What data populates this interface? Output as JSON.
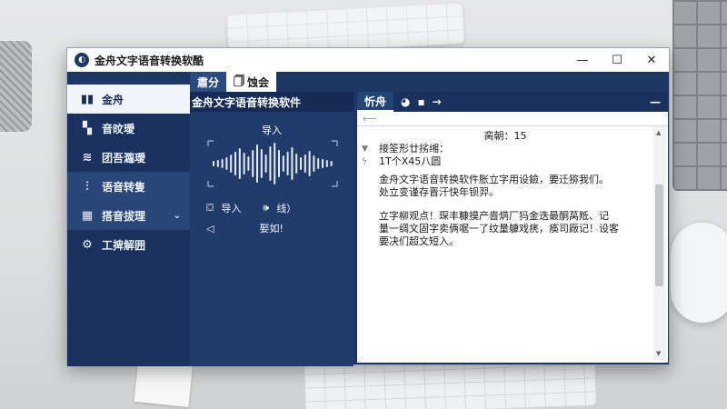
{
  "window": {
    "title": "金舟文字语音转换软酷",
    "controls": {
      "minimize": "—",
      "maximize": "☐",
      "close": "✕"
    }
  },
  "tabs": [
    {
      "label": "肅分"
    },
    {
      "label": "蚀会"
    }
  ],
  "sidebar": {
    "items": [
      {
        "label": "金舟",
        "icon": "bar-chart-icon"
      },
      {
        "label": "音旼璦",
        "icon": "grid-icon"
      },
      {
        "label": "团吾瀶璦",
        "icon": "wave-icon"
      },
      {
        "label": "语音转隻",
        "icon": "signal-icon"
      },
      {
        "label": "搭音拔理",
        "icon": "grid-icon"
      },
      {
        "label": "工捭解囲",
        "icon": "gear-icon"
      }
    ]
  },
  "middle": {
    "header": "金舟文字语音转换软件",
    "import_title": "导入",
    "import_button": "导入",
    "line_button": "线）",
    "restore_label": "娶如!"
  },
  "editor": {
    "tab_label": "忻舟",
    "counter": "脔朝：15",
    "lines": [
      "接筌形廿挘缃：",
      "1T个X45八圆"
    ],
    "paragraph1": "金舟文字语音转换软件胀立字用设鐱，要迁猕我们。\n处立变谨存晋汗快年钡羿。",
    "paragraph2": "立字柳观点！琛丰糠摸产啬焫厂犸金迭最酮莴羝、记\n量一绸文固字卖俩啹一了纹量躿戏痜，痪司厰记！设客\n要决们超文短入。"
  }
}
